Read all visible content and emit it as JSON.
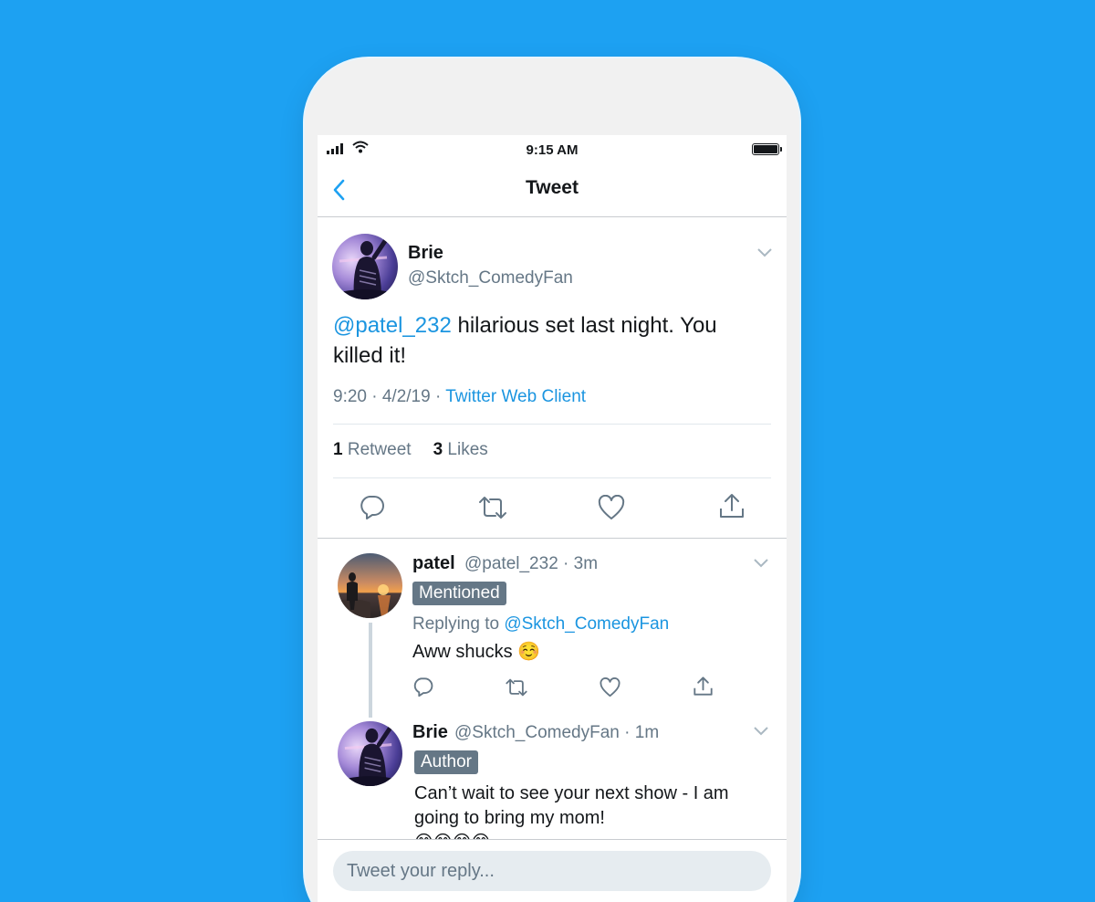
{
  "status_bar": {
    "time": "9:15 AM"
  },
  "nav": {
    "title": "Tweet"
  },
  "main_tweet": {
    "name": "Brie",
    "handle": "@Sktch_ComedyFan",
    "mention": "@patel_232",
    "text_body": " hilarious set last night. You killed it!",
    "timestamp": "9:20 · 4/2/19 · ",
    "source": "Twitter Web Client",
    "retweet_count": "1",
    "retweet_label": "Retweet",
    "like_count": "3",
    "like_label": "Likes"
  },
  "replies": [
    {
      "name": "patel",
      "handle": "@patel_232 · 3m",
      "badge": "Mentioned",
      "replying_prefix": "Replying to ",
      "replying_to": "@Sktch_ComedyFan",
      "text": "Aww shucks ☺️"
    },
    {
      "name": "Brie",
      "handle": "@Sktch_ComedyFan · 1m",
      "badge": "Author",
      "text_line1": "Can’t wait to see your next show - I am",
      "text_line2": "going to bring my mom!",
      "text_line3": "😊😊😊😊"
    }
  ],
  "reply_bar": {
    "placeholder": "Tweet your reply..."
  },
  "colors": {
    "background": "#1da1f2",
    "link": "#1b95e0",
    "secondary_text": "#657786",
    "badge": "#657786"
  }
}
